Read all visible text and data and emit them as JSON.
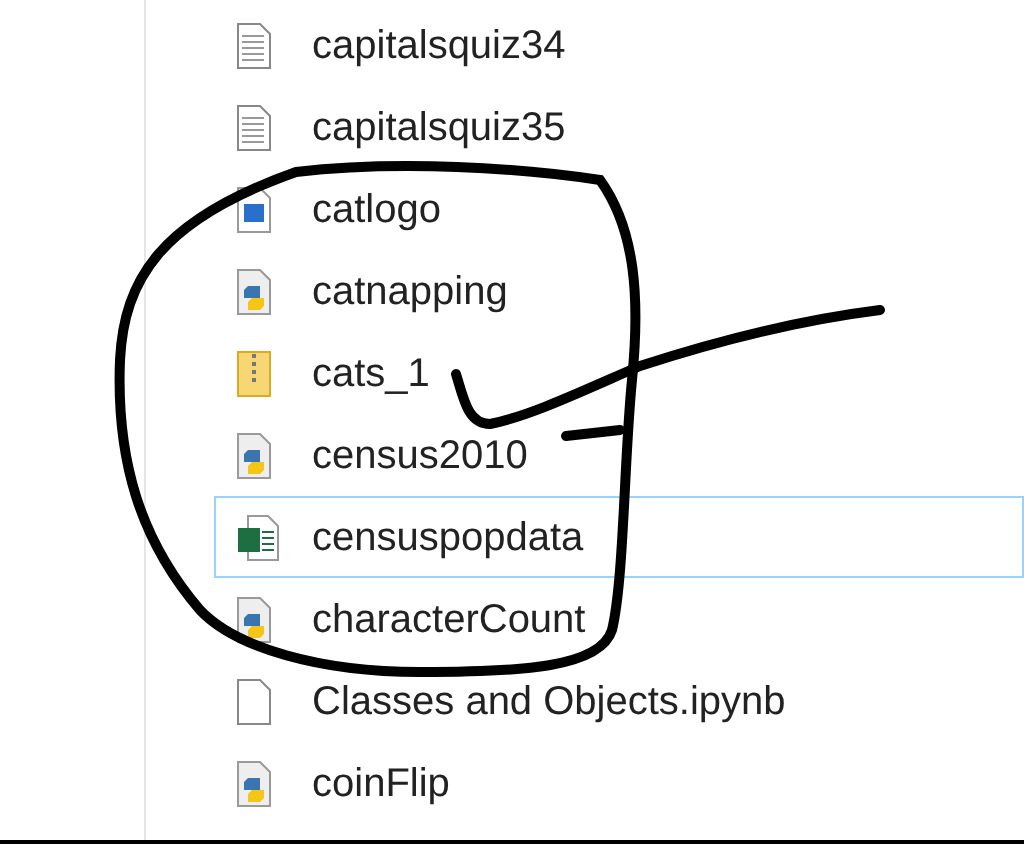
{
  "files": [
    {
      "name": "capitalsquiz34",
      "kind": "text",
      "selected": false
    },
    {
      "name": "capitalsquiz35",
      "kind": "text",
      "selected": false
    },
    {
      "name": "catlogo",
      "kind": "image",
      "selected": false
    },
    {
      "name": "catnapping",
      "kind": "python",
      "selected": false
    },
    {
      "name": "cats_1",
      "kind": "zip",
      "selected": false
    },
    {
      "name": "census2010",
      "kind": "python",
      "selected": false
    },
    {
      "name": "censuspopdata",
      "kind": "excel",
      "selected": true
    },
    {
      "name": "characterCount",
      "kind": "python",
      "selected": false
    },
    {
      "name": "Classes and Objects.ipynb",
      "kind": "blank",
      "selected": false
    },
    {
      "name": "coinFlip",
      "kind": "python",
      "selected": false
    }
  ]
}
